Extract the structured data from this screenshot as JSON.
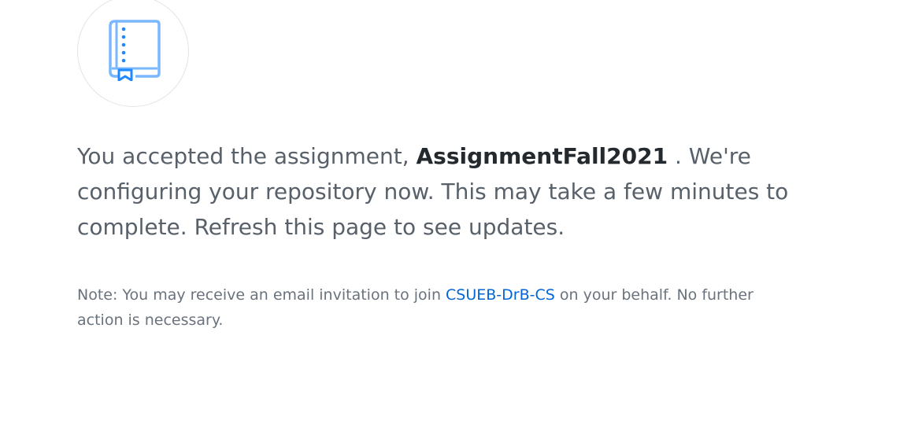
{
  "icon": {
    "name": "repo-book-icon",
    "accent_color": "#2188ff",
    "light_color": "#79b8ff"
  },
  "message": {
    "prefix": "You accepted the assignment,",
    "assignment_name": "AssignmentFall2021",
    "suffix": ". We're configuring your repository now. This may take a few minutes to complete. Refresh this page to see updates."
  },
  "note": {
    "prefix": "Note: You may receive an email invitation to join",
    "org_link": "CSUEB-DrB-CS",
    "suffix": "on your behalf. No further action is necessary."
  },
  "colors": {
    "text_primary": "#24292e",
    "text_secondary": "#586069",
    "text_muted": "#6a737d",
    "link": "#0366d6",
    "border": "#e1e4e8"
  }
}
